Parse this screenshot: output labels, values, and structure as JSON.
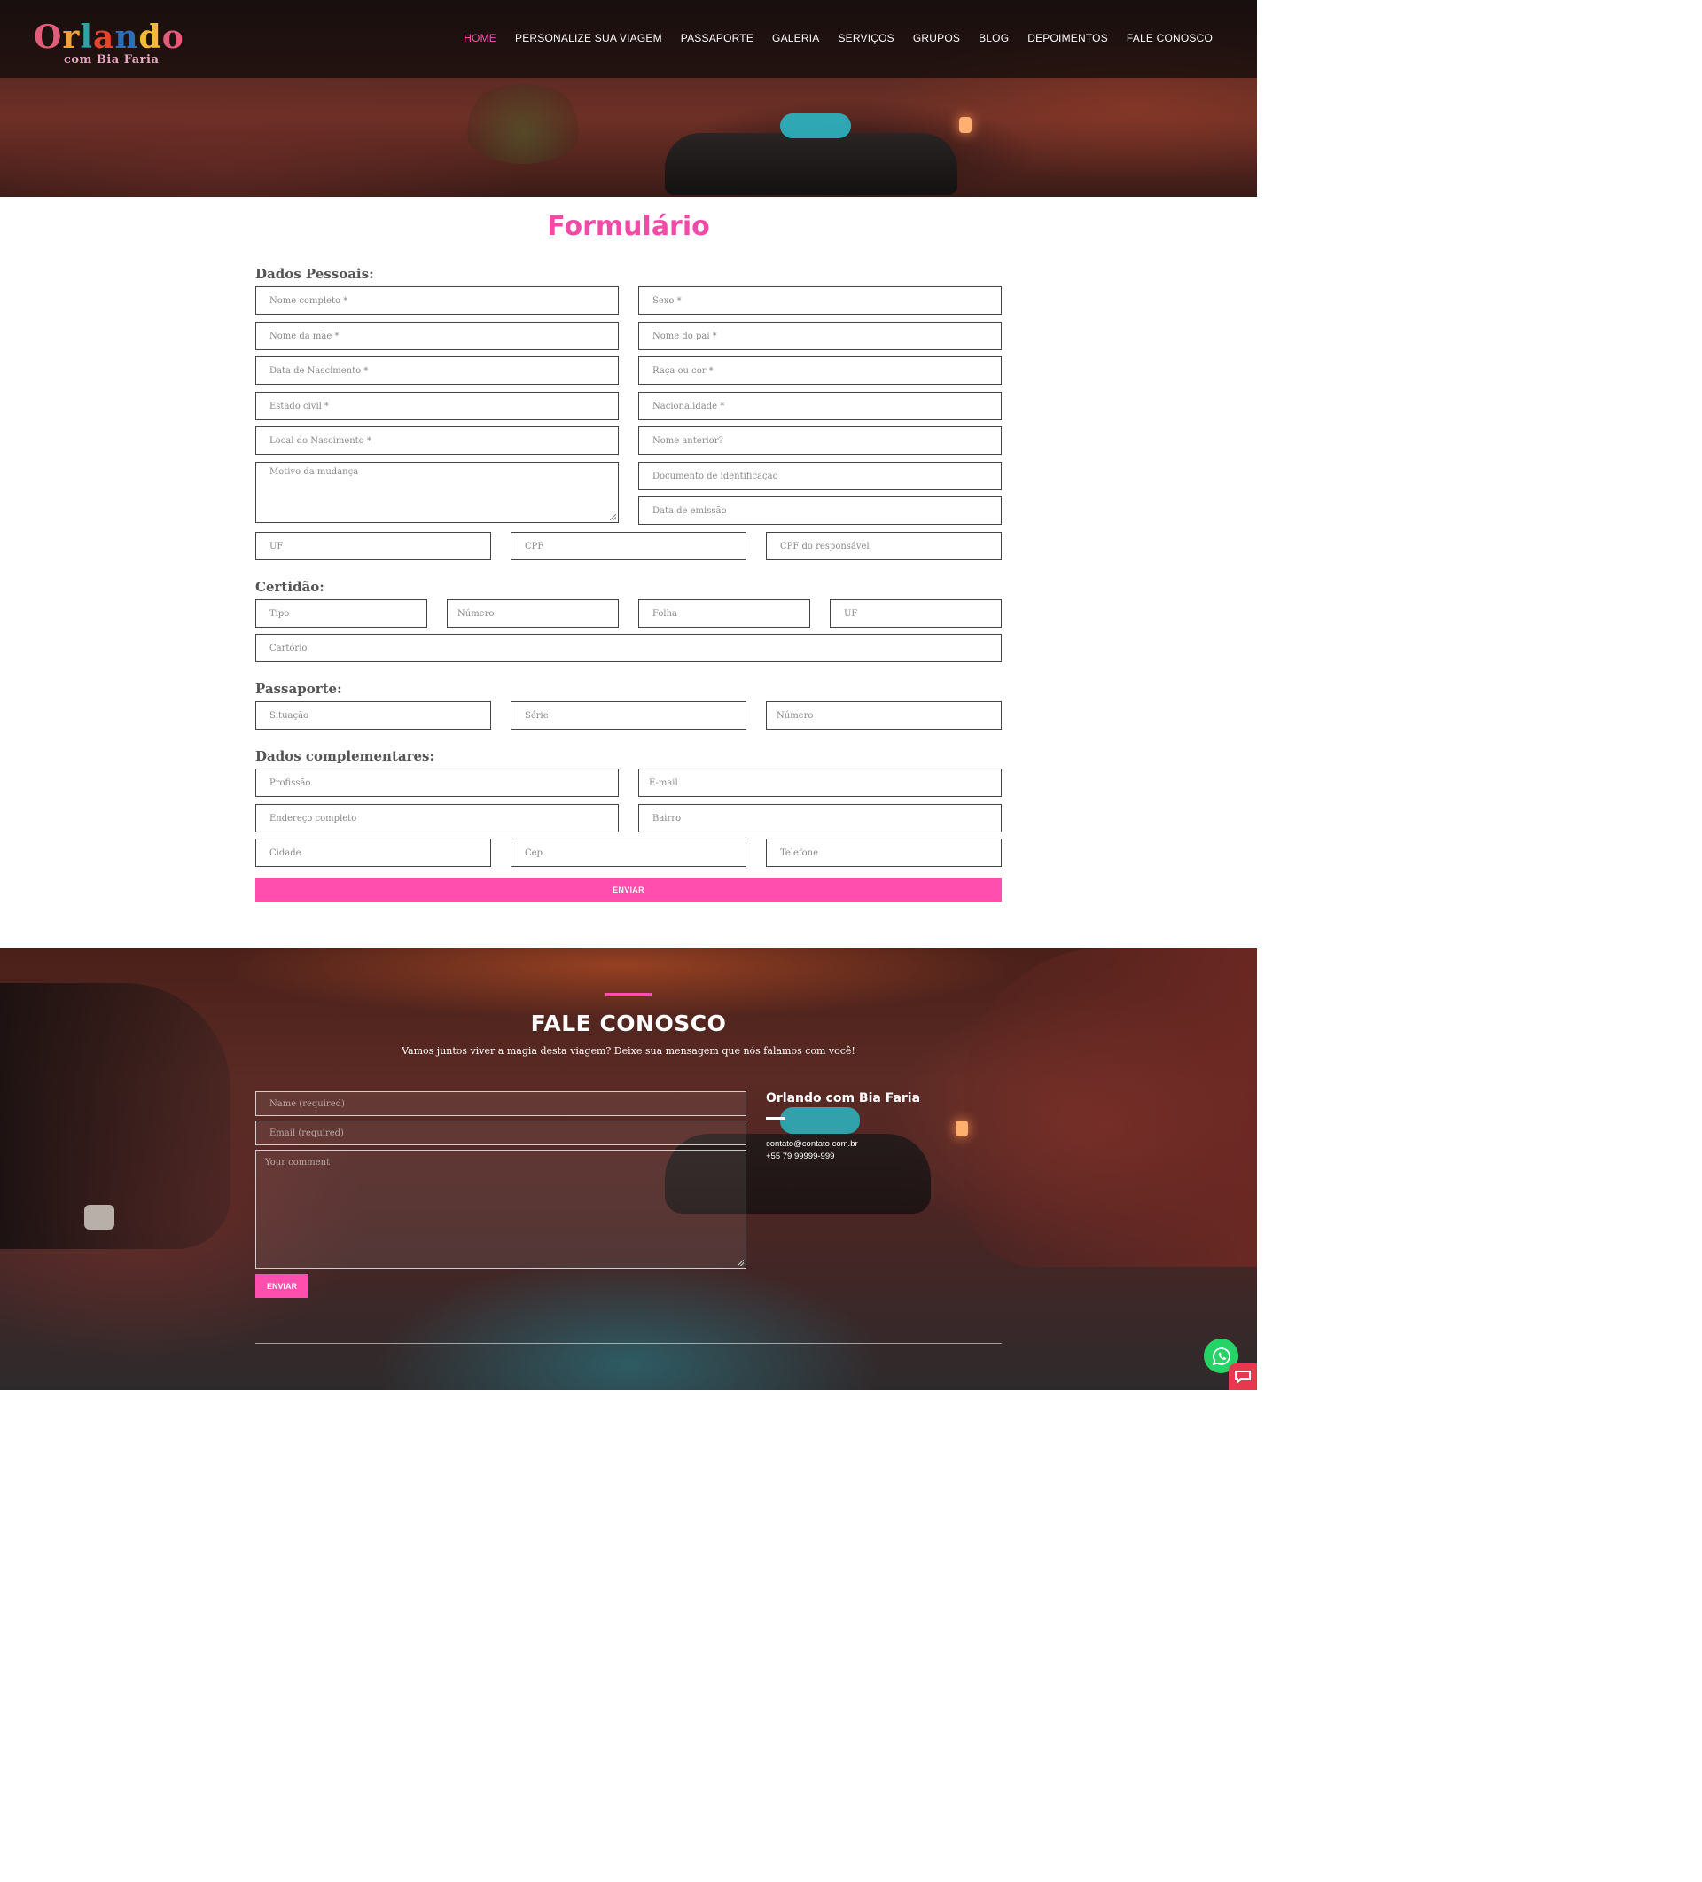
{
  "logo": {
    "letters": [
      {
        "ch": "O",
        "color": "#e35d7a"
      },
      {
        "ch": "r",
        "color": "#f0a33b"
      },
      {
        "ch": "l",
        "color": "#2ea3a5"
      },
      {
        "ch": "a",
        "color": "#e5452e"
      },
      {
        "ch": "n",
        "color": "#2d6fb6"
      },
      {
        "ch": "d",
        "color": "#f2b93b"
      },
      {
        "ch": "o",
        "color": "#e35d7a"
      }
    ],
    "subtitle": "com Bia Faria"
  },
  "nav": {
    "items": [
      {
        "label": "HOME",
        "active": true
      },
      {
        "label": "PERSONALIZE SUA VIAGEM"
      },
      {
        "label": "PASSAPORTE"
      },
      {
        "label": "GALERIA"
      },
      {
        "label": "SERVIÇOS"
      },
      {
        "label": "GRUPOS"
      },
      {
        "label": "BLOG"
      },
      {
        "label": "DEPOIMENTOS"
      },
      {
        "label": "FALE CONOSCO"
      }
    ]
  },
  "form": {
    "title": "Formulário",
    "sections": {
      "personal": "Dados Pessoais:",
      "certidao": "Certidão:",
      "passaporte": "Passaporte:",
      "complementares": "Dados complementares:"
    },
    "personal": {
      "nome_completo": "Nome completo *",
      "sexo": "Sexo *",
      "nome_mae": "Nome da mãe *",
      "nome_pai": "Nome do pai *",
      "data_nascimento": "Data de Nascimento *",
      "raca": "Raça ou cor *",
      "estado_civil": "Estado civil *",
      "nacionalidade": "Nacionalidade *",
      "local_nascimento": "Local do Nascimento *",
      "nome_anterior": "Nome anterior?",
      "motivo_mudanca": "Motivo da mudança",
      "documento": "Documento de identificação",
      "data_emissao": "Data de emissão",
      "uf": "UF",
      "cpf": "CPF",
      "cpf_responsavel": "CPF do responsável"
    },
    "certidao": {
      "tipo": "Tipo",
      "numero": "Número",
      "folha": "Folha",
      "uf": "UF",
      "cartorio": "Cartório"
    },
    "passaporte": {
      "situacao": "Situação",
      "serie": "Série",
      "numero": "Número"
    },
    "complementares": {
      "profissao": "Profissão",
      "email": "E-mail",
      "endereco": "Endereço completo",
      "bairro": "Bairro",
      "cidade": "Cidade",
      "cep": "Cep",
      "telefone": "Telefone"
    },
    "submit": "ENVIAR"
  },
  "contact": {
    "title": "FALE CONOSCO",
    "subtitle": "Vamos juntos viver a magia desta viagem? Deixe sua mensagem que nós falamos com você!",
    "name_placeholder": "Name (required)",
    "email_placeholder": "Email (required)",
    "comment_placeholder": "Your comment",
    "submit": "ENVIAR",
    "info_title": "Orlando com Bia Faria",
    "email": "contato@contato.com.br",
    "phone": "+55 79 99999-999"
  },
  "colors": {
    "accent": "#ff4eae",
    "whatsapp": "#25d366",
    "chat": "#e8384f"
  }
}
